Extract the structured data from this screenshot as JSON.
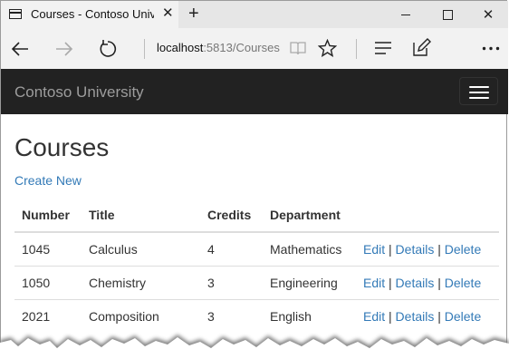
{
  "browser": {
    "tab_title": "Courses - Contoso Univ",
    "tab_close": "✕",
    "new_tab": "+",
    "address_host": "localhost",
    "address_path": ":5813/Courses",
    "icons": [
      "page-icon",
      "back-icon",
      "forward-icon",
      "refresh-icon",
      "reading-view-icon",
      "favorite-star-icon",
      "hub-icon",
      "web-note-icon",
      "more-icon"
    ]
  },
  "site": {
    "brand": "Contoso University"
  },
  "page": {
    "title": "Courses",
    "create_new": "Create New",
    "table": {
      "headers": [
        "Number",
        "Title",
        "Credits",
        "Department",
        ""
      ],
      "rows": [
        {
          "number": "1045",
          "title": "Calculus",
          "credits": "4",
          "department": "Mathematics"
        },
        {
          "number": "1050",
          "title": "Chemistry",
          "credits": "3",
          "department": "Engineering"
        },
        {
          "number": "2021",
          "title": "Composition",
          "credits": "3",
          "department": "English"
        }
      ],
      "actions": {
        "edit": "Edit",
        "details": "Details",
        "delete": "Delete",
        "separator": "|"
      }
    }
  },
  "colors": {
    "link": "#337ab7",
    "navbar_bg": "#222222",
    "brand_text": "#9d9d9d",
    "chrome_bg": "#f2f2f2"
  }
}
